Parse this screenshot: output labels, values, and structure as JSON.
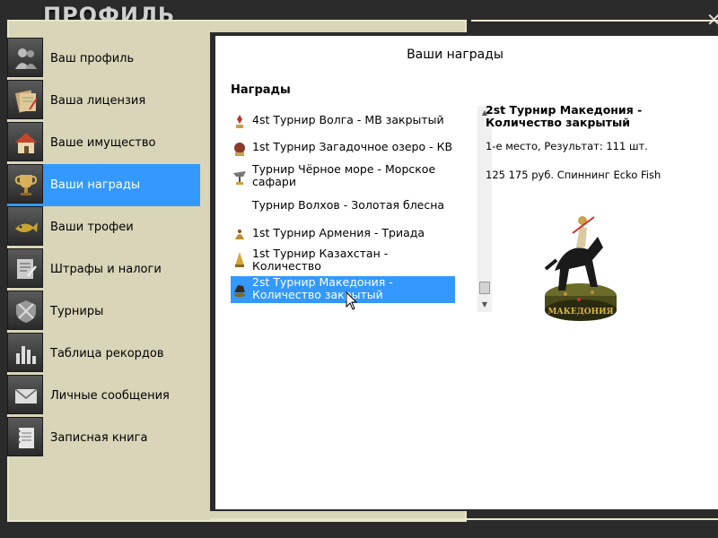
{
  "window": {
    "title": "ПРОФИЛЬ",
    "close_label": "✕"
  },
  "sidebar": {
    "items": [
      {
        "label": "Ваш профиль",
        "icon": "people-icon"
      },
      {
        "label": "Ваша лицензия",
        "icon": "document-icon"
      },
      {
        "label": "Ваше имущество",
        "icon": "house-icon"
      },
      {
        "label": "Ваши награды",
        "icon": "trophy-icon",
        "active": true
      },
      {
        "label": "Ваши трофеи",
        "icon": "fish-icon"
      },
      {
        "label": "Штрафы и налоги",
        "icon": "form-icon"
      },
      {
        "label": "Турниры",
        "icon": "badge-icon"
      },
      {
        "label": "Таблица рекордов",
        "icon": "bar-chart-icon"
      },
      {
        "label": "Личные сообщения",
        "icon": "envelope-icon"
      },
      {
        "label": "Записная книга",
        "icon": "notebook-icon"
      }
    ]
  },
  "main": {
    "title": "Ваши награды",
    "awards_heading": "Награды",
    "awards": [
      {
        "line1": "4st Турнир Волга - МВ закрытый",
        "line2": ""
      },
      {
        "line1": "1st Турнир Загадочное озеро - КВ",
        "line2": ""
      },
      {
        "line1": "Турнир Чёрное море - Морское",
        "line2": "сафари"
      },
      {
        "line1": "Турнир Волхов - Золотая блесна",
        "line2": ""
      },
      {
        "line1": "1st Турнир Армения - Триада",
        "line2": ""
      },
      {
        "line1": "1st Турнир Казахстан -",
        "line2": "Количество"
      },
      {
        "line1": "2st Турнир Македония -",
        "line2": "Количество закрытый",
        "selected": true
      }
    ],
    "detail": {
      "title": "2st Турнир Македония - Количество закрытый",
      "place_result": "1-е место, Результат: 111 шт.",
      "prize": "125 175 руб. Спиннинг Ecko Fish",
      "trophy_plate": "МАКЕДОНИЯ"
    }
  },
  "colors": {
    "accent": "#3399ff",
    "panel_beige": "#d8d5b8",
    "frame": "#2b2b2b"
  }
}
